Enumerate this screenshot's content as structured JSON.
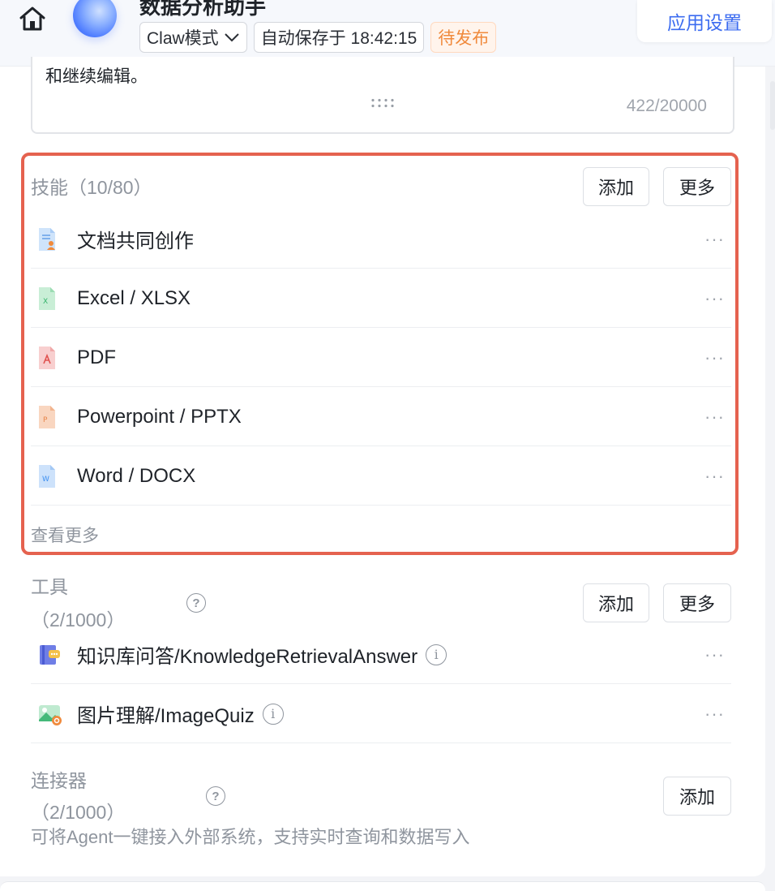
{
  "header": {
    "app_title": "数据分析助手",
    "mode": "Claw模式",
    "autosave": "自动保存于 18:42:15",
    "status": "待发布",
    "settings": "应用设置"
  },
  "prompt": {
    "tail_text": "和继续编辑。",
    "char_count": "422/20000"
  },
  "skills": {
    "title": "技能（10/80）",
    "add": "添加",
    "more": "更多",
    "items": [
      {
        "label": "文档共同创作",
        "icon": "doc-collab-icon",
        "color": "#4a90e2"
      },
      {
        "label": "Excel / XLSX",
        "icon": "excel-file-icon",
        "color": "#34b36a"
      },
      {
        "label": "PDF",
        "icon": "pdf-file-icon",
        "color": "#e0524f"
      },
      {
        "label": "Powerpoint / PPTX",
        "icon": "ppt-file-icon",
        "color": "#e8854a"
      },
      {
        "label": "Word / DOCX",
        "icon": "word-file-icon",
        "color": "#3c8ef0"
      }
    ],
    "see_more": "查看更多"
  },
  "tools": {
    "title_line1": "工具",
    "title_line2": "（2/1000）",
    "add": "添加",
    "more": "更多",
    "items": [
      {
        "label": "知识库问答/KnowledgeRetrievalAnswer",
        "icon": "knowledge-base-icon"
      },
      {
        "label": "图片理解/ImageQuiz",
        "icon": "image-understanding-icon"
      }
    ]
  },
  "connectors": {
    "title_line1": "连接器",
    "title_line2": "（2/1000）",
    "add": "添加",
    "description": "可将Agent一键接入外部系统，支持实时查询和数据写入"
  },
  "colors": {
    "accent": "#3c6cf0",
    "highlight_border": "#e5624f",
    "pending": "#f08a3c"
  }
}
